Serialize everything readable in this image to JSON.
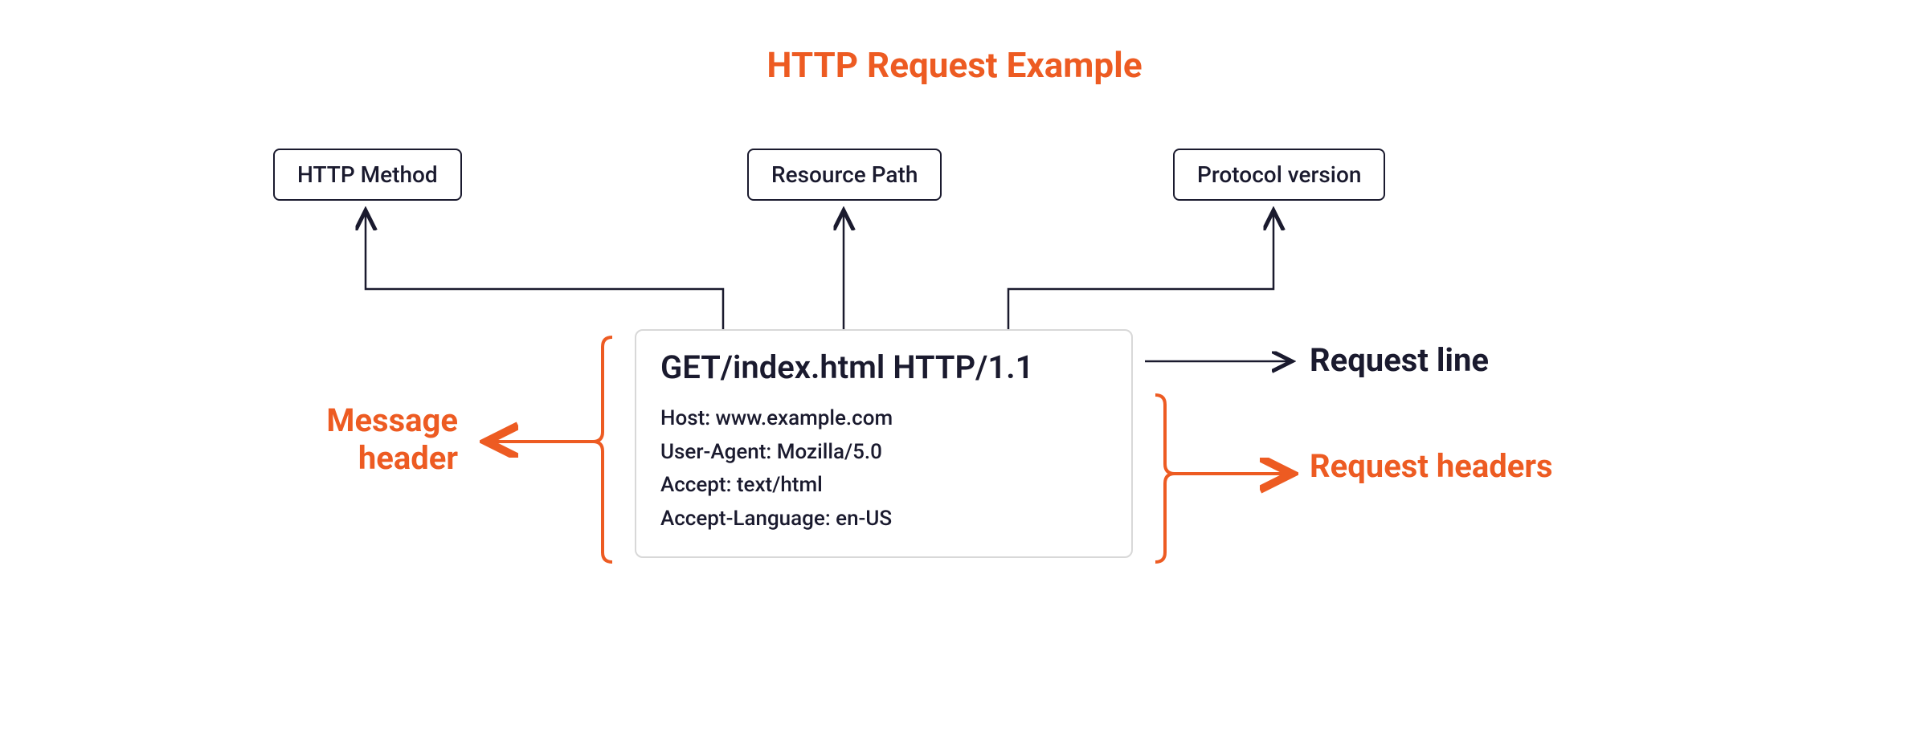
{
  "title": "HTTP Request Example",
  "labels": {
    "method": "HTTP Method",
    "resource": "Resource Path",
    "protocol": "Protocol version"
  },
  "request": {
    "line": "GET/index.html HTTP/1.1",
    "headers": [
      "Host: www.example.com",
      "User-Agent: Mozilla/5.0",
      "Accept: text/html",
      "Accept-Language: en-US"
    ]
  },
  "annotations": {
    "message_header": "Message header",
    "request_line": "Request line",
    "request_headers": "Request headers"
  },
  "colors": {
    "accent": "#ed5b22",
    "dark": "#1a1a2e",
    "gray": "#d8d8d8"
  }
}
